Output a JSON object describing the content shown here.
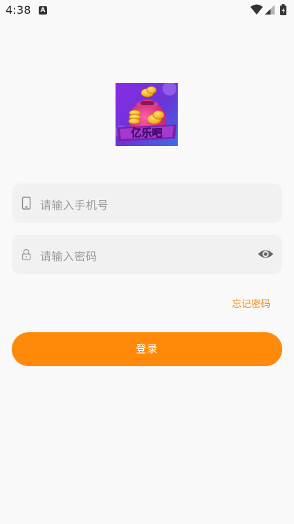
{
  "status_bar": {
    "time": "4:38",
    "notification_badge": "A"
  },
  "logo": {
    "text": "亿乐吧",
    "icon": "coin-bag-icon"
  },
  "phone_field": {
    "placeholder": "请输入手机号",
    "icon": "phone-icon"
  },
  "password_field": {
    "placeholder": "请输入密码",
    "icon": "lock-icon",
    "toggle_icon": "eye-icon"
  },
  "forgot_password": "忘记密码",
  "login_button": "登录",
  "colors": {
    "accent": "#ff8a0a",
    "link": "#f08a1a",
    "background": "#f9f9f9",
    "field_background": "#f1f1f1"
  }
}
